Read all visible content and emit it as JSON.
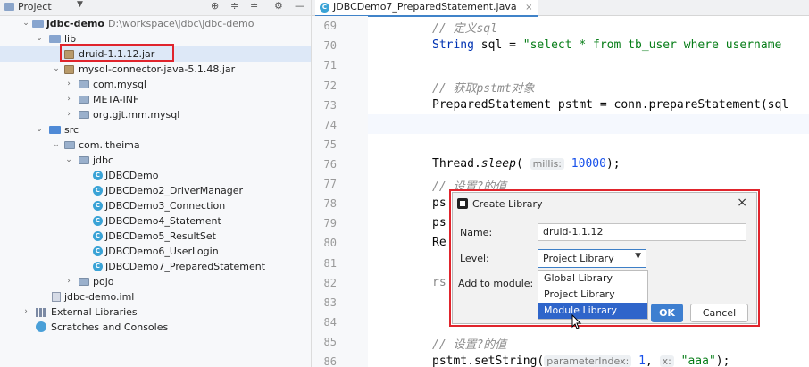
{
  "project_panel": {
    "title": "Project",
    "toolbar_icons": [
      "target-icon",
      "expand-all-icon",
      "collapse-all-icon",
      "gear-icon",
      "minimize-icon"
    ],
    "tree": [
      {
        "label": "jdbc-demo",
        "path": "D:\\workspace\\jdbc\\jdbc-demo",
        "icon": "folder",
        "expanded": true
      },
      {
        "label": "lib",
        "icon": "folder",
        "expanded": true
      },
      {
        "label": "druid-1.1.12.jar",
        "icon": "jar"
      },
      {
        "label": "mysql-connector-java-5.1.48.jar",
        "icon": "jar",
        "expanded": true
      },
      {
        "label": "com.mysql",
        "icon": "package",
        "expanded": false
      },
      {
        "label": "META-INF",
        "icon": "package",
        "expanded": false
      },
      {
        "label": "org.gjt.mm.mysql",
        "icon": "package",
        "expanded": false
      },
      {
        "label": "src",
        "icon": "source-folder",
        "expanded": true
      },
      {
        "label": "com.itheima",
        "icon": "package",
        "expanded": true
      },
      {
        "label": "jdbc",
        "icon": "package",
        "expanded": true
      },
      {
        "label": "JDBCDemo",
        "icon": "class"
      },
      {
        "label": "JDBCDemo2_DriverManager",
        "icon": "class"
      },
      {
        "label": "JDBCDemo3_Connection",
        "icon": "class"
      },
      {
        "label": "JDBCDemo4_Statement",
        "icon": "class"
      },
      {
        "label": "JDBCDemo5_ResultSet",
        "icon": "class"
      },
      {
        "label": "JDBCDemo6_UserLogin",
        "icon": "class"
      },
      {
        "label": "JDBCDemo7_PreparedStatement",
        "icon": "class"
      },
      {
        "label": "pojo",
        "icon": "package",
        "expanded": false
      },
      {
        "label": "jdbc-demo.iml",
        "icon": "iml"
      },
      {
        "label": "External Libraries",
        "icon": "library",
        "expanded": false
      },
      {
        "label": "Scratches and Consoles",
        "icon": "scratch"
      }
    ]
  },
  "editor": {
    "tab": {
      "label": "JDBCDemo7_PreparedStatement.java",
      "close": "×"
    },
    "lines": [
      {
        "no": "69",
        "comment": "// 定义sql"
      },
      {
        "no": "70",
        "type": "String",
        "var": " sql = ",
        "str": "\"select * from tb_user where username"
      },
      {
        "no": "71"
      },
      {
        "no": "72",
        "comment": "// 获取pstmt对象"
      },
      {
        "no": "73",
        "code": "PreparedStatement pstmt = conn.prepareStatement(sql"
      },
      {
        "no": "74"
      },
      {
        "no": "75"
      },
      {
        "no": "76",
        "cls": "Thread.",
        "method": "sleep",
        "open": "( ",
        "hint": "millis:",
        "num": " 10000",
        "close": ");"
      },
      {
        "no": "77",
        "comment": "// 设置?的值"
      },
      {
        "no": "78",
        "code": "ps"
      },
      {
        "no": "79",
        "code": "ps"
      },
      {
        "no": "80",
        "code": "Re"
      },
      {
        "no": "81"
      },
      {
        "no": "82",
        "code": "rs"
      },
      {
        "no": "83"
      },
      {
        "no": "84"
      },
      {
        "no": "85",
        "comment": "// 设置?的值"
      },
      {
        "no": "86",
        "code": "pstmt.setString(",
        "hint1": "parameterIndex:",
        "n1": " 1",
        "sep": ", ",
        "hint2": "x:",
        "s2": " \"aaa\"",
        "end": ");"
      }
    ]
  },
  "dialog": {
    "title": "Create Library",
    "close": "×",
    "name_label": "Name:",
    "name_value": "druid-1.1.12",
    "level_label": "Level:",
    "level_value": "Project Library",
    "module_label": "Add to module:",
    "level_options": [
      "Global Library",
      "Project Library",
      "Module Library"
    ],
    "selected_option": "Module Library",
    "ok_label": "OK",
    "cancel_label": "Cancel"
  }
}
